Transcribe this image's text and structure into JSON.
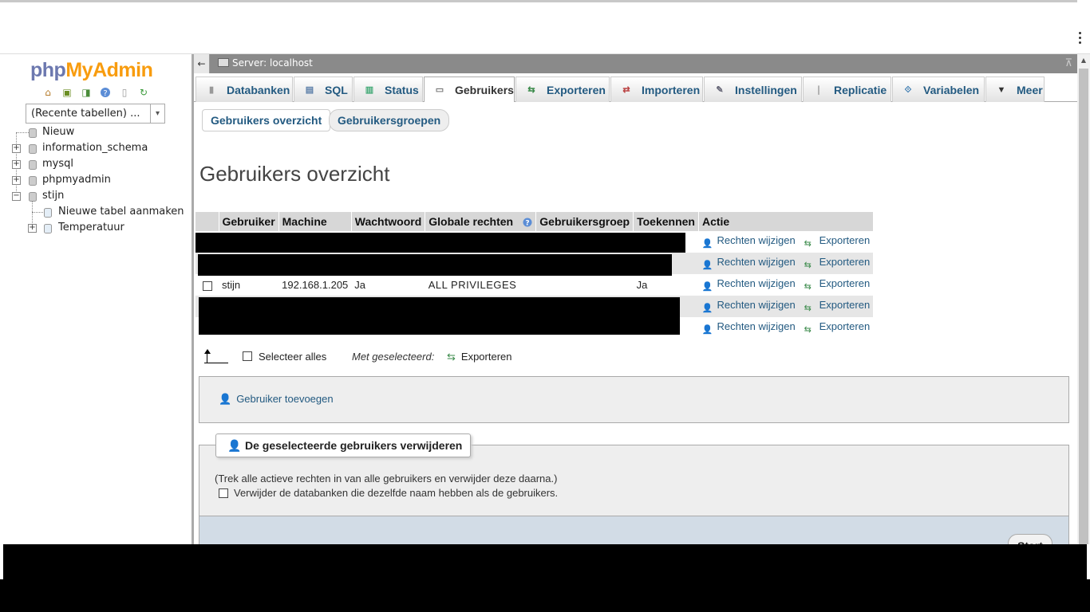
{
  "logo": {
    "php": "php",
    "my": "My",
    "admin": "Admin"
  },
  "nav": {
    "recent_select": "(Recente tabellen) ...",
    "tree": [
      {
        "label": "Nieuw"
      },
      {
        "label": "information_schema"
      },
      {
        "label": "mysql"
      },
      {
        "label": "phpmyadmin"
      },
      {
        "label": "stijn"
      },
      {
        "label": "Nieuwe tabel aanmaken"
      },
      {
        "label": "Temperatuur"
      }
    ]
  },
  "topbar": {
    "back": "←",
    "server": "Server: localhost"
  },
  "menu": [
    {
      "label": "Databanken"
    },
    {
      "label": "SQL"
    },
    {
      "label": "Status"
    },
    {
      "label": "Gebruikers"
    },
    {
      "label": "Exporteren"
    },
    {
      "label": "Importeren"
    },
    {
      "label": "Instellingen"
    },
    {
      "label": "Replicatie"
    },
    {
      "label": "Variabelen"
    },
    {
      "label": "Meer"
    }
  ],
  "subtabs": {
    "overview": "Gebruikers overzicht",
    "groups": "Gebruikersgroepen"
  },
  "page_title": "Gebruikers overzicht",
  "table": {
    "headers": [
      "Gebruiker",
      "Machine",
      "Wachtwoord",
      "Globale rechten",
      "Gebruikersgroep",
      "Toekennen",
      "Actie"
    ],
    "row": {
      "user": "stijn",
      "host": "192.168.1.205",
      "password": "Ja",
      "privileges": "ALL PRIVILEGES",
      "group": "",
      "grant": "Ja"
    },
    "edit_label": "Rechten wijzigen",
    "export_label": "Exporteren"
  },
  "bulk": {
    "select_all": "Selecteer alles",
    "with_selected": "Met geselecteerd:",
    "export": "Exporteren"
  },
  "add_user": "Gebruiker toevoegen",
  "delete": {
    "legend": "De geselecteerde gebruikers verwijderen",
    "note": "(Trek alle actieve rechten in van alle gebruikers en verwijder deze daarna.)",
    "drop_db": "Verwijder de databanken die dezelfde naam hebben als de gebruikers.",
    "start": "Start"
  }
}
